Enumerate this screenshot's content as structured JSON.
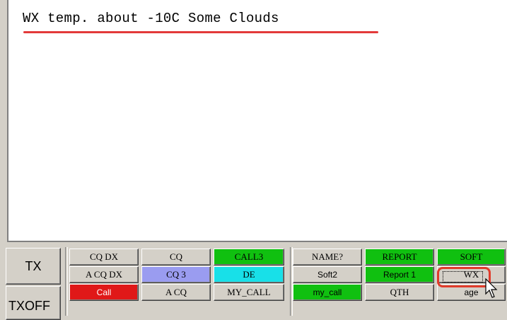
{
  "editor": {
    "text": "WX temp. about -10C Some Clouds"
  },
  "side": {
    "tx": "TX",
    "txoff": "TXOFF"
  },
  "macros": [
    {
      "label": "CQ DX",
      "bg": "#d4d0c8",
      "fg": "#000000"
    },
    {
      "label": "CQ",
      "bg": "#d4d0c8",
      "fg": "#000000"
    },
    {
      "label": "CALL3",
      "bg": "#10c010",
      "fg": "#000000"
    },
    {
      "label": "NAME?",
      "bg": "#d4d0c8",
      "fg": "#000000"
    },
    {
      "label": "REPORT",
      "bg": "#10c010",
      "fg": "#000000"
    },
    {
      "label": "SOFT",
      "bg": "#10c010",
      "fg": "#000000"
    },
    {
      "label": "A CQ DX",
      "bg": "#d4d0c8",
      "fg": "#000000"
    },
    {
      "label": "CQ 3",
      "bg": "#9a9cf0",
      "fg": "#000000"
    },
    {
      "label": "DE",
      "bg": "#18e0e8",
      "fg": "#000000"
    },
    {
      "label": "Soft2",
      "bg": "#d4d0c8",
      "fg": "#000000"
    },
    {
      "label": "Report 1",
      "bg": "#10c010",
      "fg": "#000000"
    },
    {
      "label": "WX",
      "bg": "#d4d0c8",
      "fg": "#000000"
    },
    {
      "label": "Call",
      "bg": "#e01818",
      "fg": "#ffffff"
    },
    {
      "label": "A CQ",
      "bg": "#d4d0c8",
      "fg": "#000000"
    },
    {
      "label": "MY_CALL",
      "bg": "#d4d0c8",
      "fg": "#000000"
    },
    {
      "label": "my_call",
      "bg": "#10c010",
      "fg": "#000000"
    },
    {
      "label": "QTH",
      "bg": "#d4d0c8",
      "fg": "#000000"
    },
    {
      "label": "age",
      "bg": "#d4d0c8",
      "fg": "#000000"
    }
  ]
}
